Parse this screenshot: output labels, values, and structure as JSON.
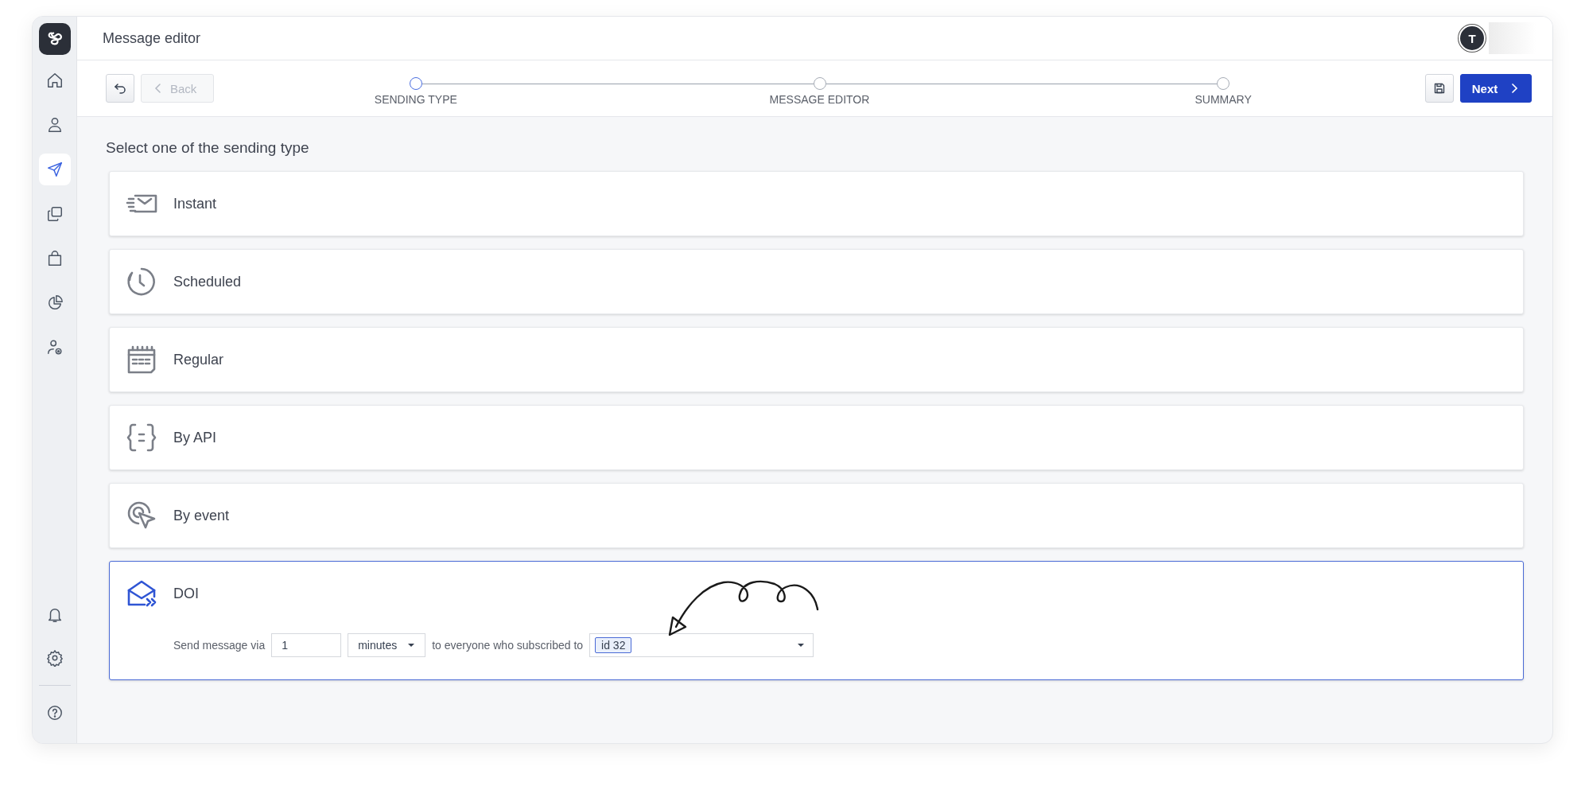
{
  "sidebar": {
    "items": [
      {
        "selected": false
      },
      {
        "selected": false
      },
      {
        "selected": true
      },
      {
        "selected": false
      },
      {
        "selected": false
      },
      {
        "selected": false
      },
      {
        "selected": false
      }
    ],
    "bottom_items": [
      {
        "selected": false
      },
      {
        "selected": false
      },
      {
        "selected": false
      }
    ]
  },
  "header": {
    "title": "Message editor",
    "avatar_initial": "T"
  },
  "toolbar": {
    "back": {
      "label": "Back",
      "disabled": true
    },
    "steps": [
      {
        "label": "SENDING TYPE",
        "selected": true
      },
      {
        "label": "MESSAGE EDITOR",
        "selected": false
      },
      {
        "label": "SUMMARY",
        "selected": false
      }
    ],
    "next": {
      "label": "Next"
    }
  },
  "heading": "Select one of the sending type",
  "options": [
    {
      "label": "Instant",
      "selected": false
    },
    {
      "label": "Scheduled",
      "selected": false
    },
    {
      "label": "Regular",
      "selected": false
    },
    {
      "label": "By API",
      "selected": false
    },
    {
      "label": "By event",
      "selected": false
    },
    {
      "label": "DOI",
      "selected": true,
      "settings": {
        "label_before": "Send message via",
        "delay_value": "1",
        "unit": "minutes",
        "label_after": "to everyone who subscribed to",
        "tags": [
          "id 32"
        ]
      }
    }
  ]
}
